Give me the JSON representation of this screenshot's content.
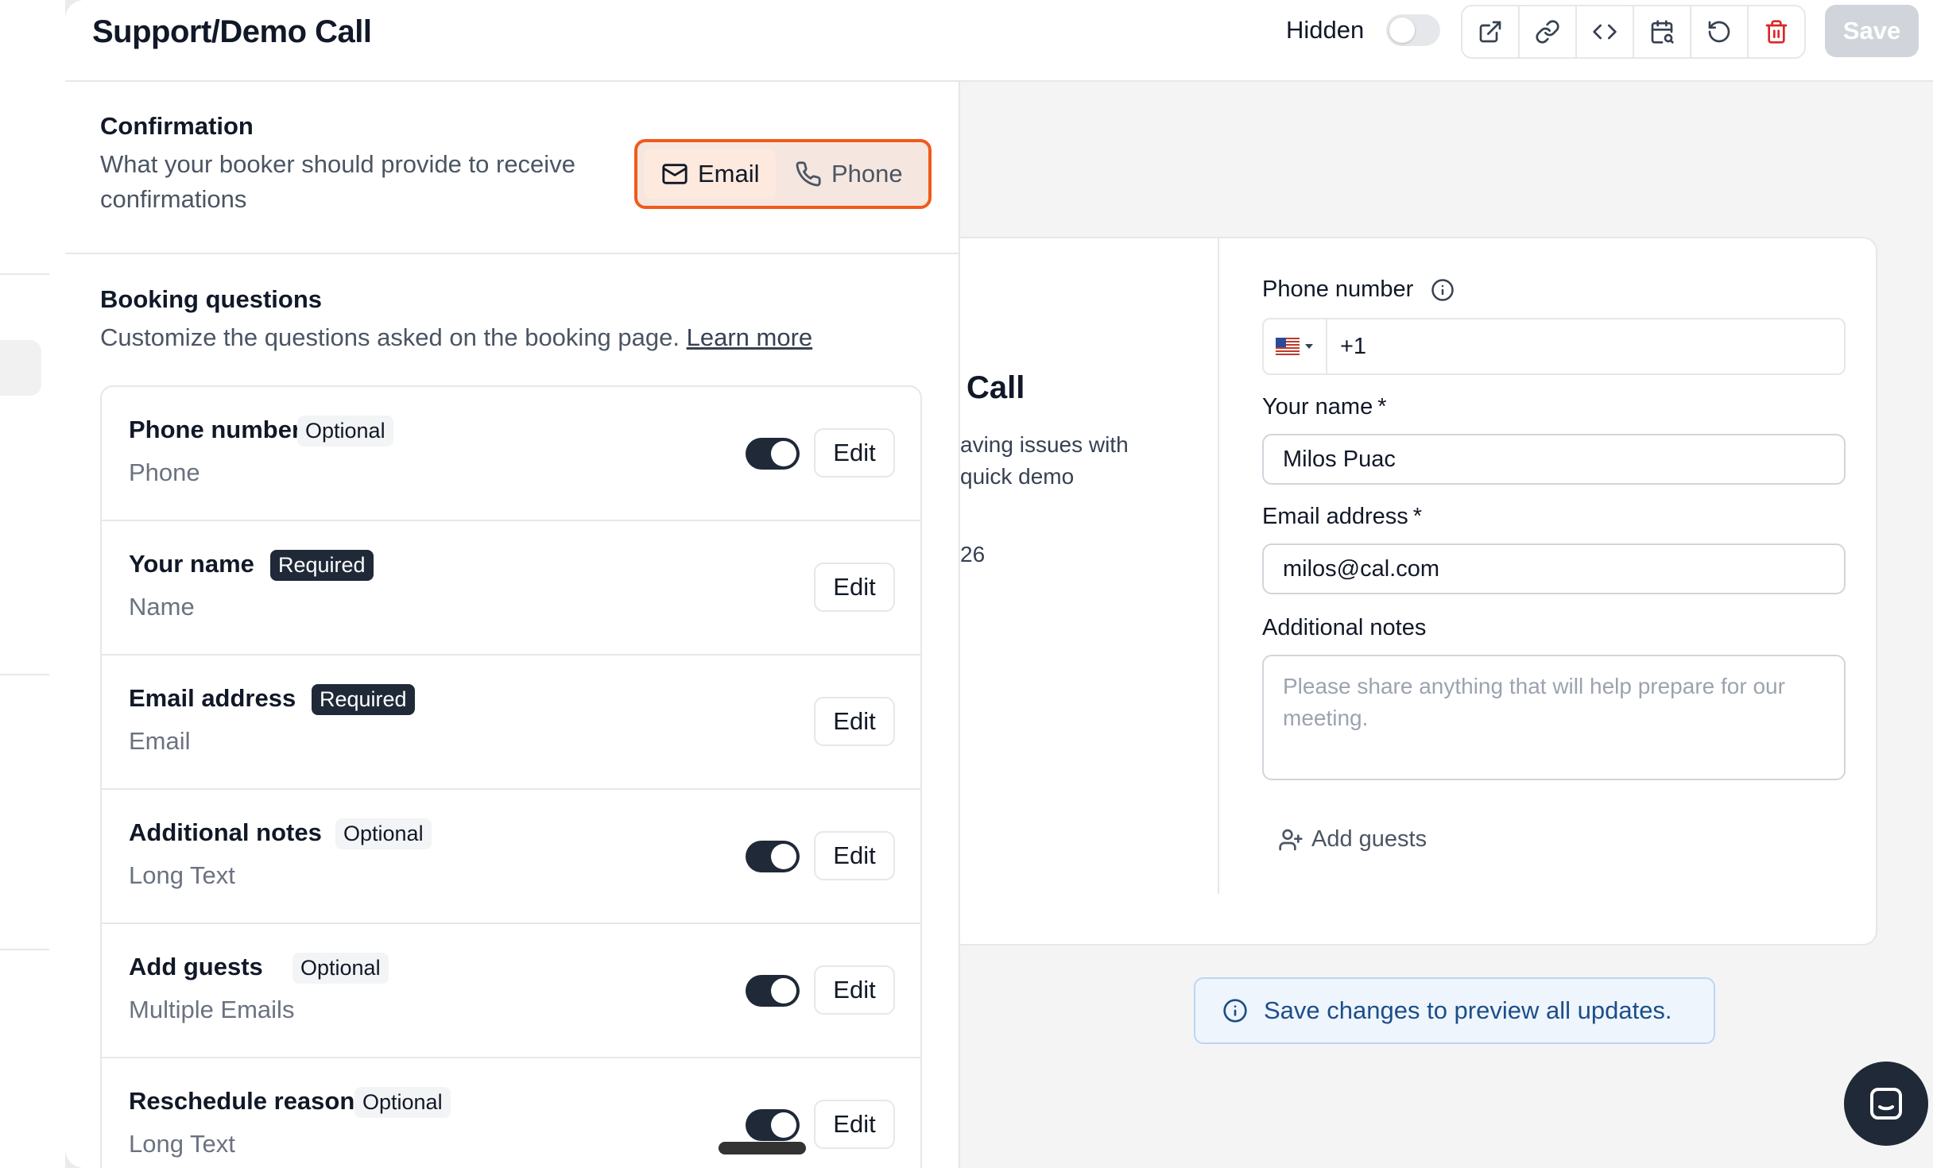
{
  "header": {
    "title": "Support/Demo Call",
    "hidden_label": "Hidden",
    "save_label": "Save",
    "toolbar_icons": [
      "external-link-icon",
      "link-icon",
      "code-icon",
      "calendar-search-icon",
      "refresh-icon",
      "trash-icon"
    ]
  },
  "confirmation": {
    "title": "Confirmation",
    "subtitle_line1": "What your booker should provide to receive",
    "subtitle_line2": "confirmations",
    "options": [
      {
        "label": "Email",
        "icon": "mail-icon",
        "selected": true
      },
      {
        "label": "Phone",
        "icon": "phone-icon",
        "selected": false
      }
    ],
    "highlight_color": "#f05a1a"
  },
  "booking_questions": {
    "title": "Booking questions",
    "subtitle": "Customize the questions asked on the booking page.",
    "learn_more": "Learn more",
    "edit_label": "Edit",
    "items": [
      {
        "label": "Phone number",
        "badge": "Optional",
        "type": "Phone",
        "toggle": true
      },
      {
        "label": "Your name",
        "badge": "Required",
        "type": "Name",
        "toggle": null
      },
      {
        "label": "Email address",
        "badge": "Required",
        "type": "Email",
        "toggle": null
      },
      {
        "label": "Additional notes",
        "badge": "Optional",
        "type": "Long Text",
        "toggle": true
      },
      {
        "label": "Add guests",
        "badge": "Optional",
        "type": "Multiple Emails",
        "toggle": true
      },
      {
        "label": "Reschedule reason",
        "badge": "Optional",
        "type": "Long Text",
        "toggle": true
      }
    ]
  },
  "preview": {
    "event_title": "Call",
    "event_desc_line1": "aving issues with",
    "event_desc_line2": "quick demo",
    "event_date_partial": "26",
    "phone_label": "Phone number",
    "phone_code": "+1",
    "name_label": "Your name",
    "name_value": "Milos Puac",
    "email_label": "Email address",
    "email_value": "milos@cal.com",
    "notes_label": "Additional notes",
    "notes_placeholder": "Please share anything that will help prepare for our meeting.",
    "add_guests": "Add guests",
    "required_mark": "*"
  },
  "notice": {
    "text": "Save changes to preview all updates."
  }
}
